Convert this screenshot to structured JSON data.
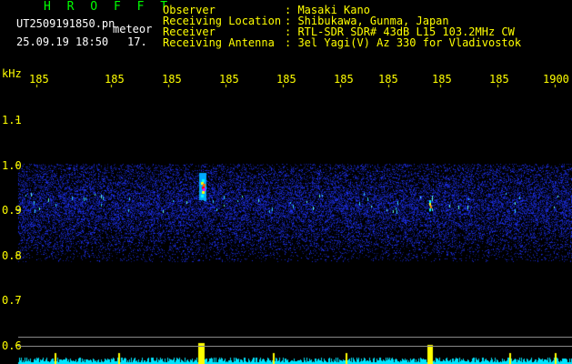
{
  "header": {
    "station_code": "H R O F F T",
    "filename": "UT2509191850.pn",
    "type_label": "meteor",
    "datetime": "25.09.19 18:50",
    "count": "17."
  },
  "info": {
    "observer_label": "Observer",
    "observer_value": ": Masaki Kano",
    "location_label": "Receiving Location",
    "location_value": ": Shibukawa, Gunma, Japan",
    "receiver_label": "Receiver",
    "receiver_value": ": RTL-SDR SDR# 43dB L15 103.2MHz CW",
    "antenna_label": "Receiving Antenna",
    "antenna_value": ": 3el Yagi(V) Az 330 for Vladivostok"
  },
  "axis": {
    "unit": "kHz",
    "x_ticks": [
      "185",
      "185",
      "185",
      "185",
      "185",
      "185",
      "185",
      "185",
      "185",
      "1900"
    ],
    "y_ticks": [
      "1.1",
      "1.0",
      "0.9",
      "0.8",
      "0.7",
      "0.6"
    ]
  },
  "colors": {
    "background": "#000000",
    "text_yellow": "#ffff00",
    "title_green": "#00ff00",
    "noise_blue": "#1a2ad0",
    "baseline_cyan": "#00e5ff"
  }
}
